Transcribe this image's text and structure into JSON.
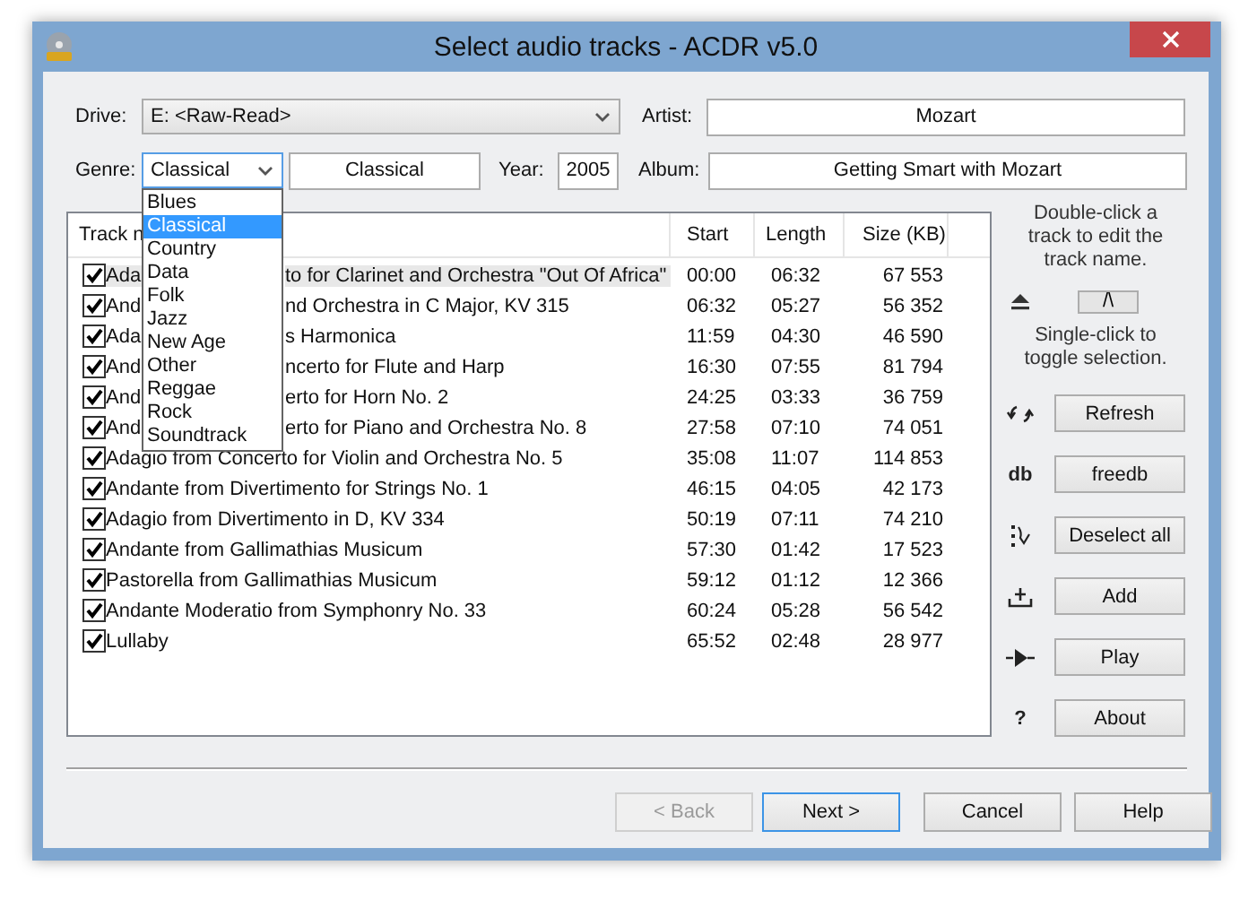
{
  "window": {
    "title": "Select audio tracks - ACDR v5.0"
  },
  "drive": {
    "label": "Drive:",
    "value": "E: <Raw-Read>"
  },
  "artist": {
    "label": "Artist:",
    "value": "Mozart"
  },
  "genre": {
    "label": "Genre:",
    "value": "Classical",
    "expanded": true,
    "text": "Classical",
    "options": [
      {
        "label": "Blues",
        "selected": false
      },
      {
        "label": "Classical",
        "selected": true
      },
      {
        "label": "Country",
        "selected": false
      },
      {
        "label": "Data",
        "selected": false
      },
      {
        "label": "Folk",
        "selected": false
      },
      {
        "label": "Jazz",
        "selected": false
      },
      {
        "label": "New Age",
        "selected": false
      },
      {
        "label": "Other",
        "selected": false
      },
      {
        "label": "Reggae",
        "selected": false
      },
      {
        "label": "Rock",
        "selected": false
      },
      {
        "label": "Soundtrack",
        "selected": false
      }
    ]
  },
  "year": {
    "label": "Year:",
    "value": "2005"
  },
  "album": {
    "label": "Album:",
    "value": "Getting Smart with Mozart"
  },
  "table": {
    "columns": [
      "Track n",
      "Start",
      "Length",
      "Size (KB)"
    ],
    "rows": [
      {
        "name": "Ada",
        "name_tail": "to for Clarinet and Orchestra \"Out Of Africa\"",
        "start": "00:00",
        "length": "06:32",
        "size": "67 553",
        "checked": true,
        "selected": true
      },
      {
        "name": "And",
        "name_tail": "nd Orchestra in C Major, KV 315",
        "start": "06:32",
        "length": "05:27",
        "size": "56 352",
        "checked": true,
        "selected": false
      },
      {
        "name": "Ada",
        "name_tail": "s Harmonica",
        "start": "11:59",
        "length": "04:30",
        "size": "46 590",
        "checked": true,
        "selected": false
      },
      {
        "name": "And",
        "name_tail": "ncerto for Flute and Harp",
        "start": "16:30",
        "length": "07:55",
        "size": "81 794",
        "checked": true,
        "selected": false
      },
      {
        "name": "And",
        "name_tail": "erto for Horn No. 2",
        "start": "24:25",
        "length": "03:33",
        "size": "36 759",
        "checked": true,
        "selected": false
      },
      {
        "name": "And",
        "name_tail": "erto for Piano and Orchestra No. 8",
        "start": "27:58",
        "length": "07:10",
        "size": "74 051",
        "checked": true,
        "selected": false
      },
      {
        "name": "Adagio from Concerto for Violin and Orchestra No. 5",
        "start": "35:08",
        "length": "11:07",
        "size": "114 853",
        "checked": true,
        "selected": false
      },
      {
        "name": "Andante from Divertimento for Strings No. 1",
        "start": "46:15",
        "length": "04:05",
        "size": "42 173",
        "checked": true,
        "selected": false
      },
      {
        "name": "Adagio from Divertimento in D, KV 334",
        "start": "50:19",
        "length": "07:11",
        "size": "74 210",
        "checked": true,
        "selected": false
      },
      {
        "name": "Andante from Gallimathias Musicum",
        "start": "57:30",
        "length": "01:42",
        "size": "17 523",
        "checked": true,
        "selected": false
      },
      {
        "name": "Pastorella from Gallimathias Musicum",
        "start": "59:12",
        "length": "01:12",
        "size": "12 366",
        "checked": true,
        "selected": false
      },
      {
        "name": "Andante Moderatio from Symphonry No. 33",
        "start": "60:24",
        "length": "05:28",
        "size": "56 542",
        "checked": true,
        "selected": false
      },
      {
        "name": "Lullaby",
        "start": "65:52",
        "length": "02:48",
        "size": "28 977",
        "checked": true,
        "selected": false
      }
    ]
  },
  "side": {
    "hint_top": "Double-click a track to edit the track name.",
    "up_button": "/\\",
    "hint_bottom": "Single-click to toggle selection.",
    "buttons": [
      {
        "kind": "refresh",
        "label": "Refresh"
      },
      {
        "kind": "glyph",
        "glyph": "db",
        "label": "freedb"
      },
      {
        "kind": "deselect",
        "label": "Deselect all"
      },
      {
        "kind": "add",
        "label": "Add"
      },
      {
        "kind": "play",
        "label": "Play"
      },
      {
        "kind": "glyph",
        "glyph": "?",
        "label": "About"
      }
    ]
  },
  "footer": [
    {
      "label": "< Back",
      "disabled": true,
      "default": false
    },
    {
      "label": "Next >",
      "disabled": false,
      "default": true
    },
    {
      "label": "Cancel",
      "disabled": false,
      "default": false
    },
    {
      "label": "Help",
      "disabled": false,
      "default": false
    }
  ]
}
